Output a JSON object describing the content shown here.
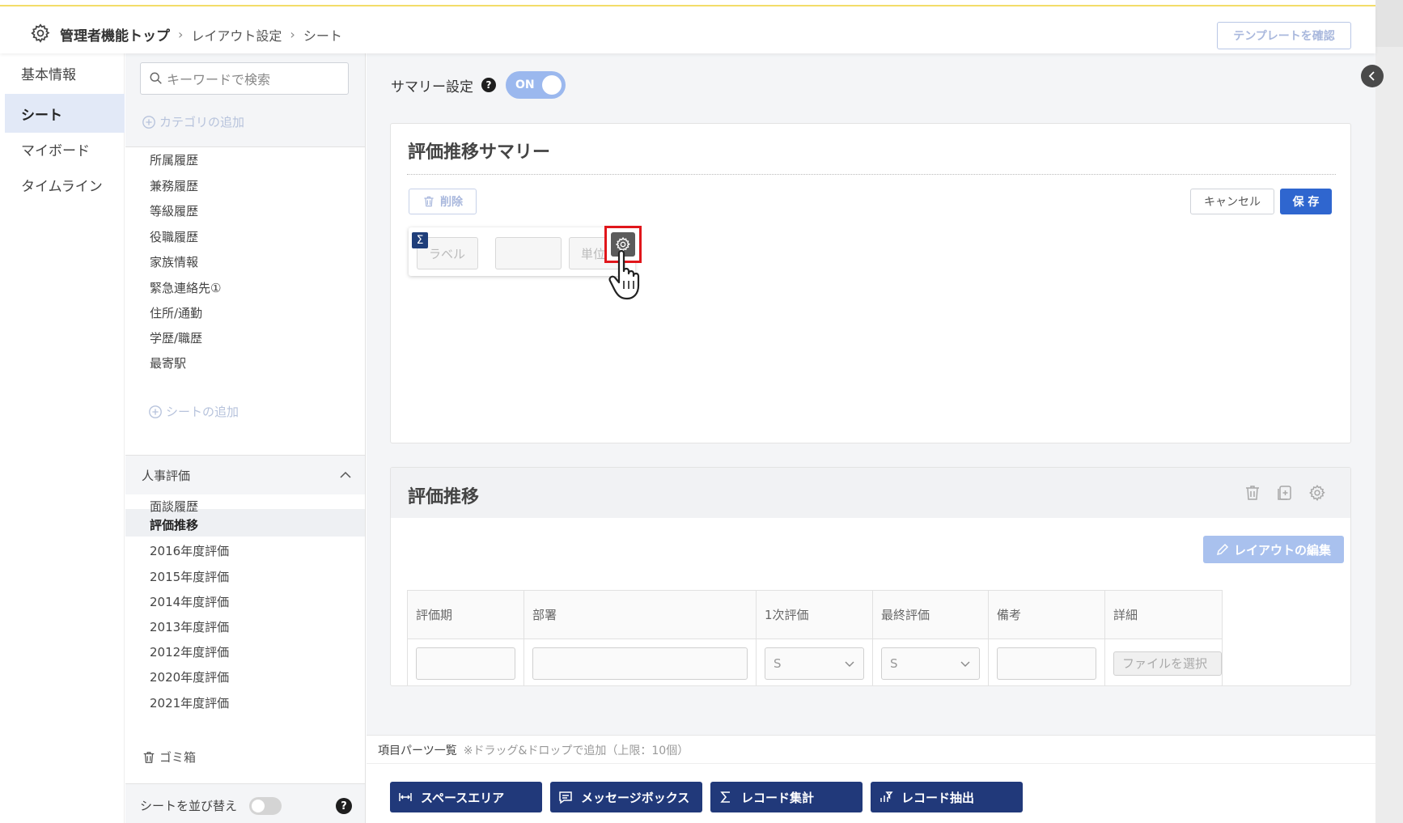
{
  "header": {
    "breadcrumb": [
      "管理者機能トップ",
      "レイアウト設定",
      "シート"
    ],
    "template_button": "テンプレートを確認"
  },
  "left_nav": {
    "items": [
      "基本情報",
      "シート",
      "マイボード",
      "タイムライン"
    ],
    "active": "シート"
  },
  "sheet_list": {
    "search_placeholder": "キーワードで検索",
    "add_category": "カテゴリの追加",
    "sheets": [
      "所属履歴",
      "兼務履歴",
      "等級履歴",
      "役職履歴",
      "家族情報",
      "緊急連絡先①",
      "住所/通勤",
      "学歴/職歴",
      "最寄駅"
    ],
    "add_sheet": "シートの追加",
    "group_name": "人事評価",
    "group_sheets": [
      "面談履歴",
      "評価推移",
      "2016年度評価",
      "2015年度評価",
      "2014年度評価",
      "2013年度評価",
      "2012年度評価",
      "2020年度評価",
      "2021年度評価"
    ],
    "active_sheet": "評価推移",
    "trash": "ゴミ箱",
    "reorder_label": "シートを並び替え"
  },
  "summary_setting": {
    "label": "サマリー設定",
    "toggle": "ON"
  },
  "summary_card": {
    "title": "評価推移サマリー",
    "delete_button": "削除",
    "cancel_button": "キャンセル",
    "save_button": "保 存",
    "widget": {
      "sigma": "Σ",
      "label_field": "ラベル",
      "unit_field": "単位"
    }
  },
  "record_card": {
    "title": "評価推移",
    "layout_edit_button": "レイアウトの編集",
    "columns": [
      "評価期",
      "部署",
      "1次評価",
      "最終評価",
      "備考",
      "詳細"
    ],
    "select_value_1": "S",
    "select_value_2": "S",
    "file_button": "ファイルを選択"
  },
  "parts": {
    "title": "項目パーツ一覧",
    "note": "※ドラッグ&ドロップで追加（上限：10個）",
    "buttons": [
      "スペースエリア",
      "メッセージボックス",
      "レコード集計",
      "レコード抽出"
    ]
  },
  "colors": {
    "primary": "#2f66cf",
    "navy": "#21397a",
    "highlight": "#e0161b",
    "toggle_on": "#9bb8ee"
  }
}
